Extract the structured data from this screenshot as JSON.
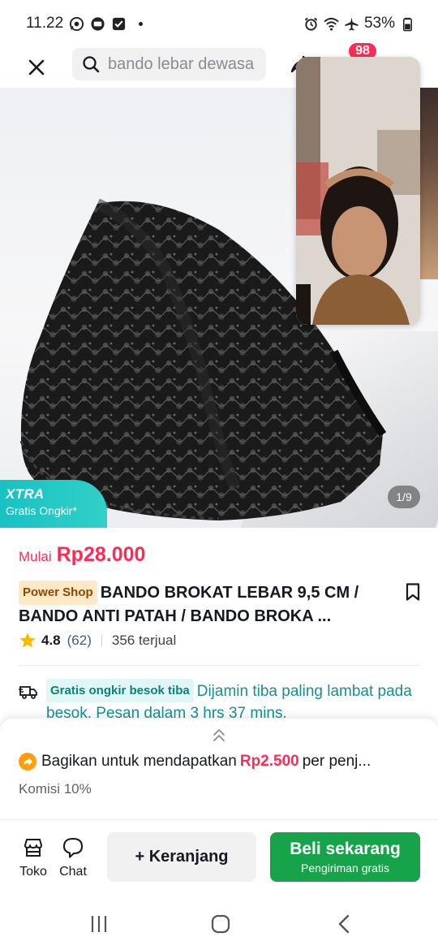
{
  "status_bar": {
    "time": "11.22",
    "battery": "53%"
  },
  "topbar": {
    "search_placeholder": "bando lebar dewasa",
    "cart_count": "98"
  },
  "hero": {
    "xtra_title": "XTRA",
    "xtra_subtitle": "Gratis Ongkir*",
    "image_counter": "1/9"
  },
  "product": {
    "price_prefix": "Mulai",
    "price": "Rp28.000",
    "shop_badge": "Power Shop",
    "title": "BANDO BROKAT LEBAR 9,5 CM / BANDO ANTI PATAH / BANDO BROKA ...",
    "rating": "4.8",
    "rating_count": "(62)",
    "sold": "356 terjual"
  },
  "shipping": {
    "tag": "Gratis ongkir besok tiba",
    "text": "Dijamin tiba paling lambat pada besok. Pesan dalam 3 hrs 37 mins."
  },
  "affiliate": {
    "prefix": "Bagikan untuk mendapatkan",
    "amount": "Rp2.500",
    "suffix": "per penj...",
    "commission": "Komisi 10%"
  },
  "actions": {
    "shop_label": "Toko",
    "chat_label": "Chat",
    "cart_button": "+ Keranjang",
    "buy_button": "Beli sekarang",
    "buy_sub": "Pengiriman gratis"
  },
  "colors": {
    "accent": "#fe2c55",
    "buy": "#17a34a",
    "xtra": "#18c1c2",
    "shipping": "#14908f"
  }
}
